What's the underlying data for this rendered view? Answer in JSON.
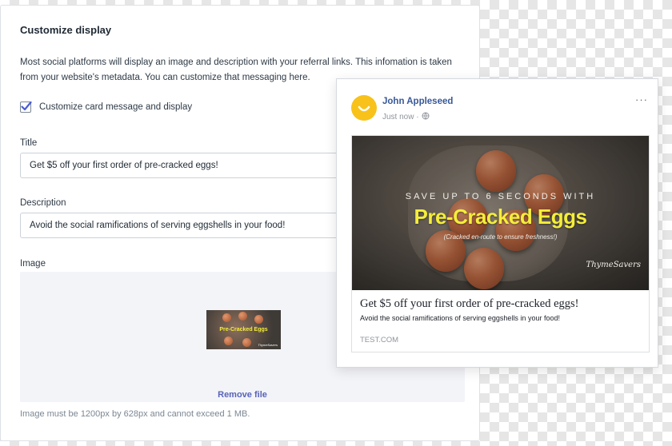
{
  "form": {
    "heading": "Customize display",
    "description": "Most social platforms will display an image and description with your referral links. This infomation is taken from your website's metadata. You can customize that messaging here.",
    "customize_checkbox": {
      "label": "Customize card message and display",
      "checked": true
    },
    "title_field": {
      "label": "Title",
      "value": "Get $5 off your first order of pre-cracked eggs!"
    },
    "description_field": {
      "label": "Description",
      "value": "Avoid the social ramifications of serving eggshells in your food!"
    },
    "image_field": {
      "label": "Image",
      "remove_label": "Remove file",
      "hint": "Image must be 1200px by 628px and cannot exceed 1 MB.",
      "thumbnail_text": "Pre-Cracked Eggs",
      "thumbnail_brand": "ThymeSavers"
    }
  },
  "preview": {
    "author": "John Appleseed",
    "timestamp": "Just now",
    "privacy_icon": "globe-icon",
    "more_icon": "ellipsis-icon",
    "image": {
      "kicker": "SAVE UP TO 6 SECONDS WITH",
      "headline": "Pre-Cracked Eggs",
      "subline": "(Cracked en-route to ensure freshness!)",
      "brand": "ThymeSavers"
    },
    "link_title": "Get $5 off your first order of pre-cracked eggs!",
    "link_description": "Avoid the social ramifications of serving eggshells in your food!",
    "domain": "TEST.COM"
  },
  "colors": {
    "accent_link": "#5863b8",
    "facebook_name": "#385898",
    "headline_yellow": "#f4ee3a",
    "avatar_yellow": "#f8c21a"
  }
}
